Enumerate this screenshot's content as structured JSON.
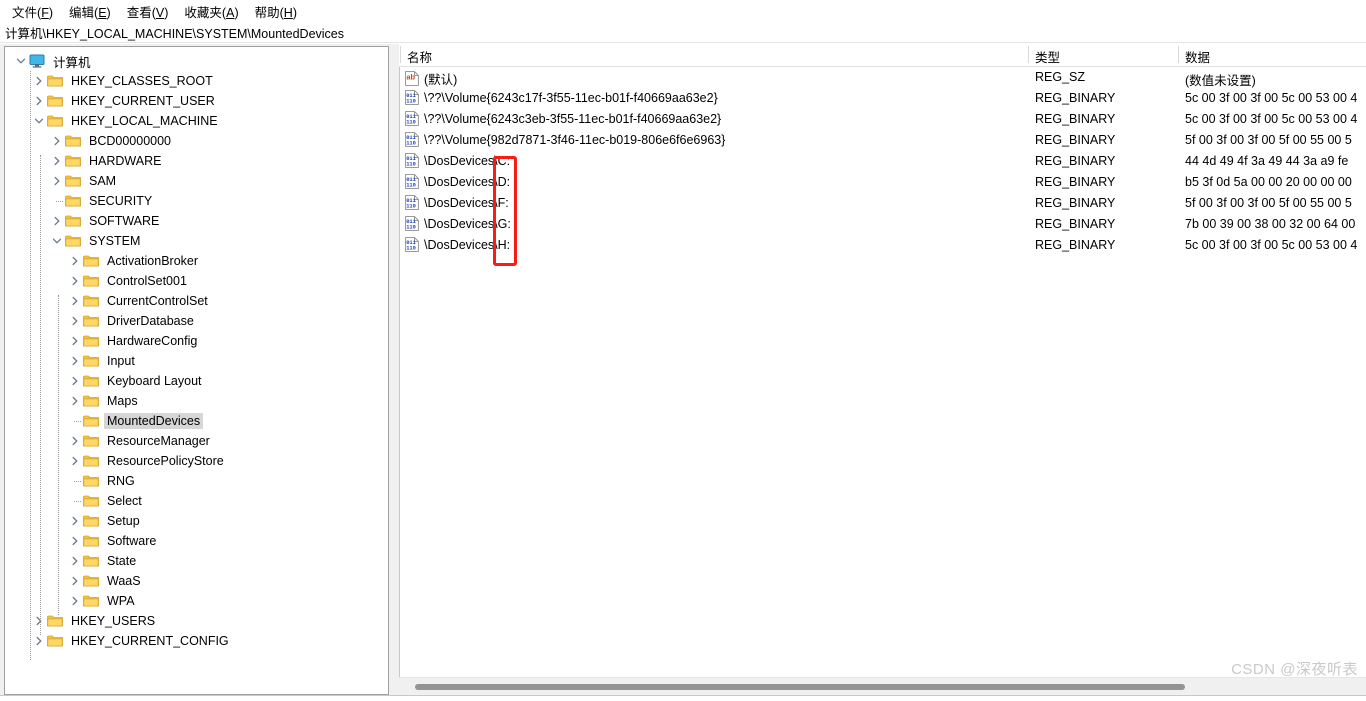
{
  "menu": {
    "items": [
      {
        "text": "文件",
        "acc": "F"
      },
      {
        "text": "编辑",
        "acc": "E"
      },
      {
        "text": "查看",
        "acc": "V"
      },
      {
        "text": "收藏夹",
        "acc": "A"
      },
      {
        "text": "帮助",
        "acc": "H"
      }
    ]
  },
  "address": {
    "path": "计算机\\HKEY_LOCAL_MACHINE\\SYSTEM\\MountedDevices"
  },
  "tree": {
    "root": {
      "label": "计算机",
      "icon": "computer-icon",
      "expanded": true
    },
    "nodes": [
      {
        "label": "HKEY_CLASSES_ROOT",
        "depth": 1,
        "state": "collapsed",
        "selected": false
      },
      {
        "label": "HKEY_CURRENT_USER",
        "depth": 1,
        "state": "collapsed",
        "selected": false
      },
      {
        "label": "HKEY_LOCAL_MACHINE",
        "depth": 1,
        "state": "expanded",
        "selected": false
      },
      {
        "label": "BCD00000000",
        "depth": 2,
        "state": "collapsed",
        "selected": false
      },
      {
        "label": "HARDWARE",
        "depth": 2,
        "state": "collapsed",
        "selected": false
      },
      {
        "label": "SAM",
        "depth": 2,
        "state": "collapsed",
        "selected": false
      },
      {
        "label": "SECURITY",
        "depth": 2,
        "state": "leaf",
        "selected": false
      },
      {
        "label": "SOFTWARE",
        "depth": 2,
        "state": "collapsed",
        "selected": false
      },
      {
        "label": "SYSTEM",
        "depth": 2,
        "state": "expanded",
        "selected": false
      },
      {
        "label": "ActivationBroker",
        "depth": 3,
        "state": "collapsed",
        "selected": false
      },
      {
        "label": "ControlSet001",
        "depth": 3,
        "state": "collapsed",
        "selected": false
      },
      {
        "label": "CurrentControlSet",
        "depth": 3,
        "state": "collapsed",
        "selected": false
      },
      {
        "label": "DriverDatabase",
        "depth": 3,
        "state": "collapsed",
        "selected": false
      },
      {
        "label": "HardwareConfig",
        "depth": 3,
        "state": "collapsed",
        "selected": false
      },
      {
        "label": "Input",
        "depth": 3,
        "state": "collapsed",
        "selected": false
      },
      {
        "label": "Keyboard Layout",
        "depth": 3,
        "state": "collapsed",
        "selected": false
      },
      {
        "label": "Maps",
        "depth": 3,
        "state": "collapsed",
        "selected": false
      },
      {
        "label": "MountedDevices",
        "depth": 3,
        "state": "leaf",
        "selected": true
      },
      {
        "label": "ResourceManager",
        "depth": 3,
        "state": "collapsed",
        "selected": false
      },
      {
        "label": "ResourcePolicyStore",
        "depth": 3,
        "state": "collapsed",
        "selected": false
      },
      {
        "label": "RNG",
        "depth": 3,
        "state": "leaf",
        "selected": false
      },
      {
        "label": "Select",
        "depth": 3,
        "state": "leaf",
        "selected": false
      },
      {
        "label": "Setup",
        "depth": 3,
        "state": "collapsed",
        "selected": false
      },
      {
        "label": "Software",
        "depth": 3,
        "state": "collapsed",
        "selected": false
      },
      {
        "label": "State",
        "depth": 3,
        "state": "collapsed",
        "selected": false
      },
      {
        "label": "WaaS",
        "depth": 3,
        "state": "collapsed",
        "selected": false
      },
      {
        "label": "WPA",
        "depth": 3,
        "state": "collapsed",
        "selected": false
      },
      {
        "label": "HKEY_USERS",
        "depth": 1,
        "state": "collapsed",
        "selected": false
      },
      {
        "label": "HKEY_CURRENT_CONFIG",
        "depth": 1,
        "state": "collapsed",
        "selected": false
      }
    ]
  },
  "list": {
    "columns": [
      "名称",
      "类型",
      "数据"
    ],
    "rows": [
      {
        "icon": "string-value-icon",
        "name": "(默认)",
        "type": "REG_SZ",
        "data": "(数值未设置)"
      },
      {
        "icon": "binary-value-icon",
        "name": "\\??\\Volume{6243c17f-3f55-11ec-b01f-f40669aa63e2}",
        "type": "REG_BINARY",
        "data": "5c 00 3f 00 3f 00 5c 00 53 00 4"
      },
      {
        "icon": "binary-value-icon",
        "name": "\\??\\Volume{6243c3eb-3f55-11ec-b01f-f40669aa63e2}",
        "type": "REG_BINARY",
        "data": "5c 00 3f 00 3f 00 5c 00 53 00 4"
      },
      {
        "icon": "binary-value-icon",
        "name": "\\??\\Volume{982d7871-3f46-11ec-b019-806e6f6e6963}",
        "type": "REG_BINARY",
        "data": "5f 00 3f 00 3f 00 5f 00 55 00 5"
      },
      {
        "icon": "binary-value-icon",
        "name": "\\DosDevices\\C:",
        "type": "REG_BINARY",
        "data": "44 4d 49 4f 3a 49 44 3a a9 fe"
      },
      {
        "icon": "binary-value-icon",
        "name": "\\DosDevices\\D:",
        "type": "REG_BINARY",
        "data": "b5 3f 0d 5a 00 00 20 00 00 00"
      },
      {
        "icon": "binary-value-icon",
        "name": "\\DosDevices\\F:",
        "type": "REG_BINARY",
        "data": "5f 00 3f 00 3f 00 5f 00 55 00 5"
      },
      {
        "icon": "binary-value-icon",
        "name": "\\DosDevices\\G:",
        "type": "REG_BINARY",
        "data": "7b 00 39 00 38 00 32 00 64 00"
      },
      {
        "icon": "binary-value-icon",
        "name": "\\DosDevices\\H:",
        "type": "REG_BINARY",
        "data": "5c 00 3f 00 3f 00 5c 00 53 00 4"
      }
    ]
  },
  "annotation": {
    "color": "#f91c14",
    "highlights": [
      "C:",
      "D:",
      "F:",
      "G:",
      "H:"
    ]
  },
  "watermark": {
    "text": "CSDN @深夜听表"
  }
}
